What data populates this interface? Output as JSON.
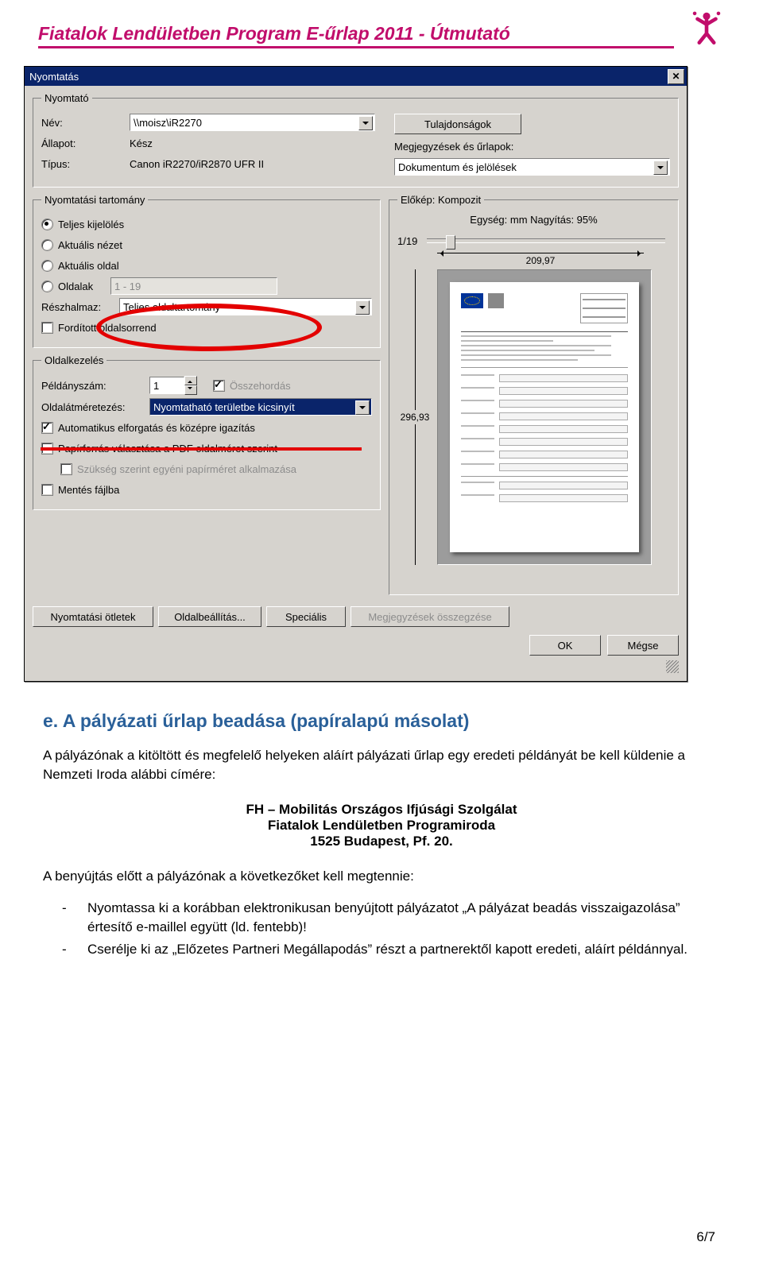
{
  "header": {
    "title": "Fiatalok Lendületben Program E-űrlap 2011 - Útmutató"
  },
  "dialog": {
    "title": "Nyomtatás",
    "printer": {
      "legend": "Nyomtató",
      "name_lbl": "Név:",
      "name_val": "\\\\moisz\\iR2270",
      "status_lbl": "Állapot:",
      "status_val": "Kész",
      "type_lbl": "Típus:",
      "type_val": "Canon iR2270/iR2870 UFR II",
      "props_btn": "Tulajdonságok",
      "notes_lbl": "Megjegyzések és űrlapok:",
      "notes_val": "Dokumentum és jelölések"
    },
    "range": {
      "legend": "Nyomtatási tartomány",
      "all": "Teljes kijelölés",
      "view": "Aktuális nézet",
      "page": "Aktuális oldal",
      "pages": "Oldalak",
      "pages_val": "1 - 19",
      "subset_lbl": "Részhalmaz:",
      "subset_val": "Teljes oldaltartomány",
      "reverse": "Fordított oldalsorrend"
    },
    "handling": {
      "legend": "Oldalkezelés",
      "copies_lbl": "Példányszám:",
      "copies_val": "1",
      "collate": "Összehordás",
      "scale_lbl": "Oldalátméretezés:",
      "scale_val": "Nyomtatható területbe kicsinyít",
      "rotate": "Automatikus elforgatás és középre igazítás",
      "papersrc": "Papírforrás választása a PDF oldalméret szerint",
      "custom": "Szükség szerint egyéni papírméret alkalmazása",
      "save": "Mentés fájlba"
    },
    "preview": {
      "legend": "Előkép: Kompozit",
      "units": "Egység: mm Nagyítás:  95%",
      "page_ind": "1/19",
      "width": "209,97",
      "height": "296,93"
    },
    "buttons": {
      "tips": "Nyomtatási ötletek",
      "pagesetup": "Oldalbeállítás...",
      "special": "Speciális",
      "summary": "Megjegyzések összegzése",
      "ok": "OK",
      "cancel": "Mégse"
    }
  },
  "section_e": {
    "heading": "e. A pályázati űrlap beadása (papíralapú másolat)",
    "para1": "A pályázónak a kitöltött és megfelelő helyeken aláírt pályázati űrlap egy eredeti példányát be kell küldenie a Nemzeti Iroda alábbi címére:",
    "addr1": "FH – Mobilitás Országos Ifjúsági Szolgálat",
    "addr2": "Fiatalok Lendületben Programiroda",
    "addr3": "1525 Budapest, Pf. 20.",
    "para2": "A benyújtás előtt a pályázónak a következőket kell megtennie:",
    "li1": "Nyomtassa ki a korábban elektronikusan benyújtott pályázatot „A pályázat beadás visszaigazolása” értesítő e-maillel együtt (ld. fentebb)!",
    "li2": "Cserélje ki az „Előzetes Partneri Megállapodás” részt a partnerektől kapott eredeti, aláírt példánnyal."
  },
  "page_number": "6/7"
}
